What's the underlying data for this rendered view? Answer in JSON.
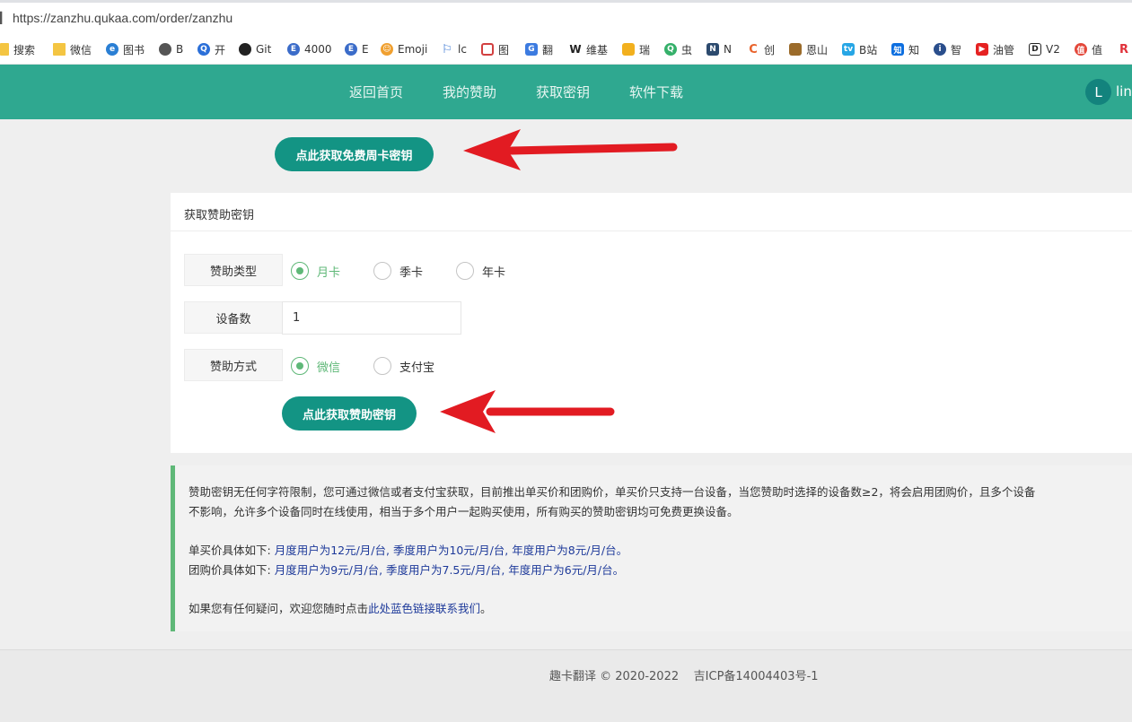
{
  "browser": {
    "url": "https://zanzhu.qukaa.com/order/zanzhu",
    "bookmarks": [
      {
        "label": "搜索",
        "icon": "folder-icon",
        "color": "#f4c542"
      },
      {
        "label": "微信",
        "icon": "folder-icon",
        "color": "#f4c542"
      },
      {
        "label": "图书",
        "icon": "ie-icon",
        "color": "#2a7fd4"
      },
      {
        "label": "B",
        "icon": "globe-icon",
        "color": "#555555"
      },
      {
        "label": "开",
        "icon": "search-q-icon",
        "color": "#2b6fd8"
      },
      {
        "label": "Git",
        "icon": "github-icon",
        "color": "#222222"
      },
      {
        "label": "4000",
        "icon": "e-icon",
        "color": "#3b6cc9"
      },
      {
        "label": "E",
        "icon": "e-icon",
        "color": "#3b6cc9"
      },
      {
        "label": "Emoji",
        "icon": "emoji-icon",
        "color": "#f0a030"
      },
      {
        "label": "lc",
        "icon": "flag-icon",
        "color": "#2f6fd0"
      },
      {
        "label": "图",
        "icon": "image-icon",
        "color": "#d24040"
      },
      {
        "label": "翻",
        "icon": "translate-icon",
        "color": "#3c7be0"
      },
      {
        "label": "维基",
        "icon": "wiki-icon",
        "color": "#222222"
      },
      {
        "label": "瑞",
        "icon": "hand-icon",
        "color": "#f2b01e"
      },
      {
        "label": "虫",
        "icon": "q-icon",
        "color": "#35b06a"
      },
      {
        "label": "N",
        "icon": "n-icon",
        "color": "#2c4a6e"
      },
      {
        "label": "创",
        "icon": "c-icon",
        "color": "#e9622b"
      },
      {
        "label": "恩山",
        "icon": "enshan-icon",
        "color": "#9b6b2a"
      },
      {
        "label": "B站",
        "icon": "bilibili-icon",
        "color": "#27a6e5"
      },
      {
        "label": "知",
        "icon": "zhihu-icon",
        "color": "#0d6fe0"
      },
      {
        "label": "智",
        "icon": "info-icon",
        "color": "#2a4e8c"
      },
      {
        "label": "油管",
        "icon": "youtube-icon",
        "color": "#e52222"
      },
      {
        "label": "V2",
        "icon": "v2-icon",
        "color": "#222222"
      },
      {
        "label": "值",
        "icon": "zhi-icon",
        "color": "#e3483a"
      },
      {
        "label": "R",
        "icon": "r-icon",
        "color": "#e0323a"
      }
    ]
  },
  "nav": {
    "links": [
      "返回首页",
      "我的赞助",
      "获取密钥",
      "软件下载"
    ],
    "avatar_letter": "L",
    "username": "lin"
  },
  "free_button": "点此获取免费周卡密钥",
  "form": {
    "title": "获取赞助密钥",
    "type_label": "赞助类型",
    "type_options": [
      "月卡",
      "季卡",
      "年卡"
    ],
    "device_label": "设备数",
    "device_value": "1",
    "pay_label": "赞助方式",
    "pay_options": [
      "微信",
      "支付宝"
    ],
    "submit": "点此获取赞助密钥"
  },
  "notice": {
    "line1": "赞助密钥无任何字符限制，您可通过微信或者支付宝获取，目前推出单买价和团购价，单买价只支持一台设备，当您赞助时选择的设备数≥2，将会启用团购价，且多个设备",
    "line2": "不影响，允许多个设备同时在线使用，相当于多个用户一起购买使用，所有购买的赞助密钥均可免费更换设备。",
    "single_prefix": "单买价具体如下: ",
    "single_prices": "月度用户为12元/月/台, 季度用户为10元/月/台, 年度用户为8元/月/台。",
    "group_prefix": "团购价具体如下: ",
    "group_prices": "月度用户为9元/月/台, 季度用户为7.5元/月/台, 年度用户为6元/月/台。",
    "contact_prefix": "如果您有任何疑问，欢迎您随时点击",
    "contact_link": "此处蓝色链接联系我们",
    "contact_suffix": "。"
  },
  "footer": "趣卡翻译 © 2020-2022    吉ICP备14004403号-1",
  "colors": {
    "nav_bg": "#2fa890",
    "button": "#139484",
    "radio_checked": "#5fb878",
    "arrow": "#e21b22",
    "link": "#1e3a9a"
  }
}
